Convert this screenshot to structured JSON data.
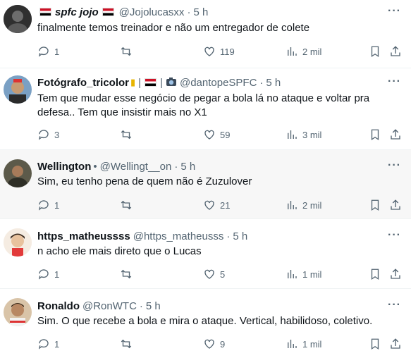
{
  "tweets": [
    {
      "display_name": "spfc jojo",
      "handle": "@Jojolucasxx",
      "time": "5 h",
      "text": "finalmente temos treinador e não um entregador de colete",
      "replies": "1",
      "retweets": "",
      "likes": "119",
      "views": "2 mil",
      "avatar_color": "#3a3a3a"
    },
    {
      "display_name": "Fotógrafo_tricolor",
      "handle": "@dantopeSPFC",
      "time": "5 h",
      "text": "Tem que mudar esse negócio de pegar a bola lá no ataque e voltar pra defesa.. Tem que insistir mais no X1",
      "replies": "3",
      "retweets": "",
      "likes": "59",
      "views": "3 mil",
      "avatar_color": "#8a6d4a"
    },
    {
      "display_name": "Wellington",
      "handle": "@Wellingt__on",
      "time": "5 h",
      "text": "Sim, eu tenho pena de quem não é Zuzulover",
      "replies": "1",
      "retweets": "",
      "likes": "21",
      "views": "2 mil",
      "avatar_color": "#4b4b3c"
    },
    {
      "display_name": "https_matheussss",
      "handle": "@https_matheusss",
      "time": "5 h",
      "text": "n acho ele mais direto que o Lucas",
      "replies": "1",
      "retweets": "",
      "likes": "5",
      "views": "1 mil",
      "avatar_color": "#f2e6d8"
    },
    {
      "display_name": "Ronaldo",
      "handle": "@RonWTC",
      "time": "5 h",
      "text": "Sim. O que recebe a bola e mira o ataque. Vertical, habilidoso, coletivo.",
      "replies": "1",
      "retweets": "",
      "likes": "9",
      "views": "1 mil",
      "avatar_color": "#c9a27a"
    }
  ],
  "separators": {
    "bar": "|"
  },
  "more_label": "···",
  "icons": [
    "reply-icon",
    "retweet-icon",
    "like-icon",
    "views-icon",
    "bookmark-icon",
    "share-icon",
    "more-icon",
    "flag-icon",
    "camera-icon",
    "trophy-icon"
  ]
}
